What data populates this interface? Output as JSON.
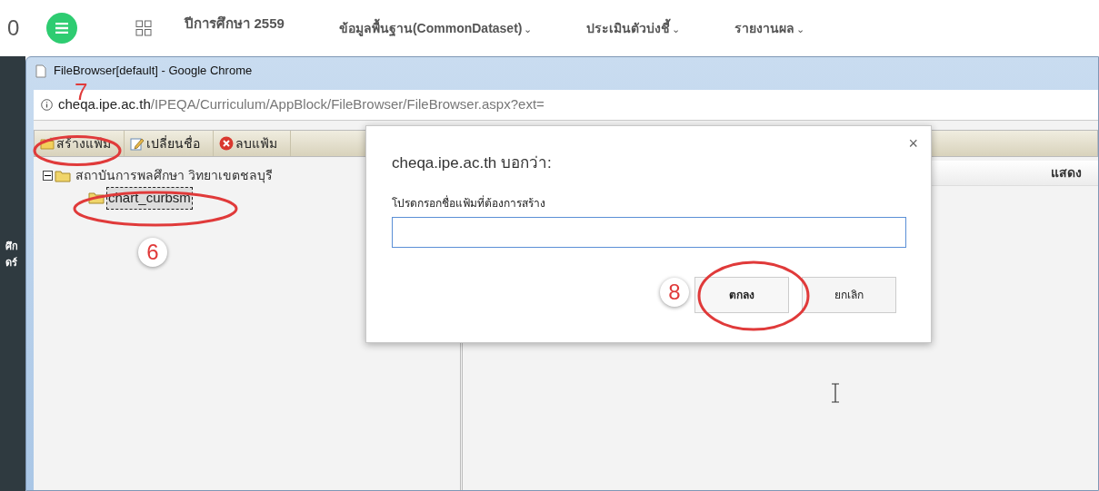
{
  "nav": {
    "counter": "0",
    "year": "ปีการศึกษา 2559",
    "menus": [
      {
        "label": "ข้อมูลพื้นฐาน(CommonDataset)",
        "caret": "⌄"
      },
      {
        "label": "ประเมินตัวบ่งชี้",
        "caret": "⌄"
      },
      {
        "label": "รายงานผล",
        "caret": "⌄"
      }
    ]
  },
  "background_fragments": [
    "ศึก",
    "ดร์"
  ],
  "window": {
    "title": "FileBrowser[default] - Google Chrome",
    "url_host": "cheqa.ipe.ac.th",
    "url_path": "/IPEQA/Curriculum/AppBlock/FileBrowser/FileBrowser.aspx?ext="
  },
  "toolbar": [
    {
      "kind": "new-folder",
      "label": "สร้างแฟ้ม"
    },
    {
      "kind": "rename",
      "label": "เปลี่ยนชื่อ"
    },
    {
      "kind": "delete",
      "label": "ลบแฟ้ม"
    }
  ],
  "tree": {
    "label": "สถาบันการพลศึกษา วิทยาเขตชลบุรี",
    "expanded": true,
    "children": [
      {
        "label": "chart_curbsm",
        "selected": true
      }
    ]
  },
  "file_list": {
    "column_header": "แสดง"
  },
  "dialog": {
    "title": "cheqa.ipe.ac.th บอกว่า:",
    "message": "โปรดกรอกชื่อแฟ้มที่ต้องการสร้าง",
    "close": "×",
    "buttons": [
      {
        "label": "ตกลง",
        "kind": "primary"
      },
      {
        "label": "ยกเลิก",
        "kind": "secondary"
      }
    ]
  },
  "annotations": [
    {
      "number": "7"
    },
    {
      "number": "6"
    },
    {
      "number": "8"
    }
  ]
}
